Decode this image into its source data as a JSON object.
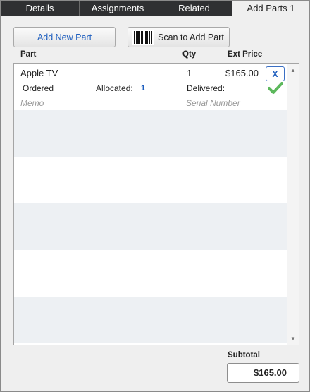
{
  "tabs": [
    {
      "label": "Details"
    },
    {
      "label": "Assignments"
    },
    {
      "label": "Related"
    },
    {
      "label": "Add Parts 1"
    }
  ],
  "toolbar": {
    "add_label": "Add New Part",
    "scan_label": "Scan to Add Part"
  },
  "columns": {
    "part": "Part",
    "qty": "Qty",
    "ext_price": "Ext Price"
  },
  "items": [
    {
      "name": "Apple TV",
      "qty": "1",
      "price": "$165.00",
      "remove_label": "X",
      "ordered_label": "Ordered",
      "allocated_label": "Allocated:",
      "allocated_value": "1",
      "delivered_label": "Delivered:",
      "memo_placeholder": "Memo",
      "serial_placeholder": "Serial Number"
    }
  ],
  "subtotal": {
    "label": "Subtotal",
    "value": "$165.00"
  },
  "colors": {
    "tab_bg": "#2f3032",
    "accent": "#1f5fbf",
    "check": "#5cb85c",
    "row_alt": "#edf0f3"
  }
}
